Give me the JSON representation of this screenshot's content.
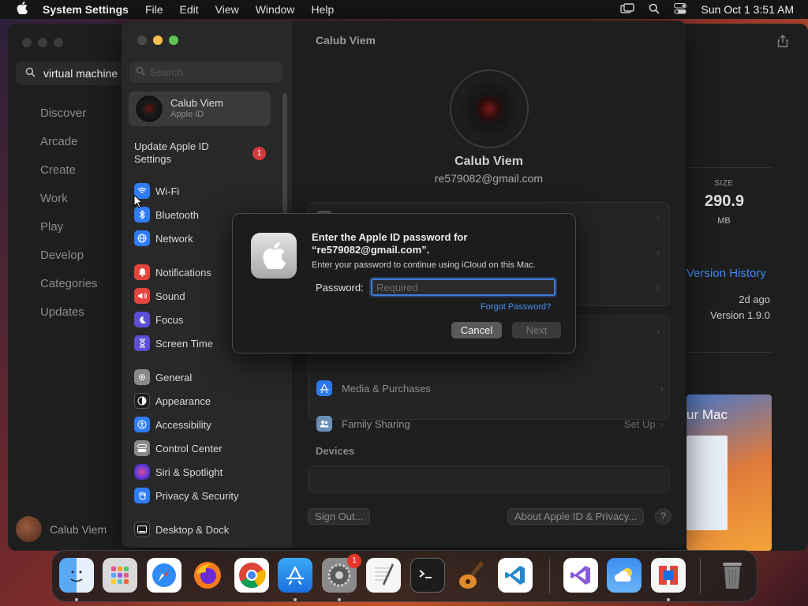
{
  "menubar": {
    "app_name": "System Settings",
    "items": [
      "File",
      "Edit",
      "View",
      "Window",
      "Help"
    ],
    "clock": "Sun Oct 1  3:51 AM"
  },
  "appstore": {
    "search_value": "virtual machine",
    "nav": [
      "Discover",
      "Arcade",
      "Create",
      "Work",
      "Play",
      "Develop",
      "Categories",
      "Updates"
    ],
    "user_name": "Calub Viem",
    "size_label": "SIZE",
    "size_value": "290.9",
    "size_unit": "MB",
    "version_history": "Version History",
    "updated_ago": "2d ago",
    "version": "Version 1.9.0",
    "promo_text": "ur Mac"
  },
  "sidebar": {
    "search_placeholder": "Search",
    "profile_name": "Calub Viem",
    "profile_sub": "Apple ID",
    "update_label": "Update Apple ID Settings",
    "update_badge": "1",
    "items": [
      {
        "label": "Wi-Fi",
        "icon": "wifi-icon",
        "color": "#2f7cf6"
      },
      {
        "label": "Bluetooth",
        "icon": "bluetooth-icon",
        "color": "#2f7cf6"
      },
      {
        "label": "Network",
        "icon": "globe-icon",
        "color": "#2f7cf6"
      },
      {
        "label": "Notifications",
        "icon": "bell-icon",
        "color": "#e2453c"
      },
      {
        "label": "Sound",
        "icon": "speaker-icon",
        "color": "#e2453c"
      },
      {
        "label": "Focus",
        "icon": "moon-icon",
        "color": "#5b4fd6"
      },
      {
        "label": "Screen Time",
        "icon": "hourglass-icon",
        "color": "#5b4fd6"
      },
      {
        "label": "General",
        "icon": "gear-icon",
        "color": "#8a8a8a"
      },
      {
        "label": "Appearance",
        "icon": "appearance-icon",
        "color": "#1c1c1c"
      },
      {
        "label": "Accessibility",
        "icon": "accessibility-icon",
        "color": "#2f7cf6"
      },
      {
        "label": "Control Center",
        "icon": "control-center-icon",
        "color": "#8a8a8a"
      },
      {
        "label": "Siri & Spotlight",
        "icon": "siri-icon",
        "color": "#b44ad8"
      },
      {
        "label": "Privacy & Security",
        "icon": "hand-icon",
        "color": "#2f7cf6"
      },
      {
        "label": "Desktop & Dock",
        "icon": "dock-icon",
        "color": "#1c1c1c"
      }
    ]
  },
  "content": {
    "title": "Calub Viem",
    "name": "Calub Viem",
    "email": "re579082@gmail.com",
    "rows": [
      {
        "label": "Media & Purchases",
        "trail": "",
        "icon": "app-store-icon",
        "color": "#2f7cf6"
      },
      {
        "label": "Family Sharing",
        "trail": "Set Up",
        "icon": "family-icon",
        "color": "#6a8fb8"
      }
    ],
    "devices_header": "Devices",
    "sign_out": "Sign Out...",
    "about": "About Apple ID & Privacy...",
    "help": "?"
  },
  "dialog": {
    "title": "Enter the Apple ID password for “re579082@gmail.com”.",
    "subtitle": "Enter your password to continue using iCloud on this Mac.",
    "password_label": "Password:",
    "password_placeholder": "Required",
    "forgot": "Forgot Password?",
    "cancel": "Cancel",
    "next": "Next"
  },
  "dock": {
    "settings_badge": "1",
    "apps": [
      "Finder",
      "Launchpad",
      "Safari",
      "Firefox",
      "Chrome",
      "App Store",
      "System Settings",
      "TextEdit",
      "Terminal",
      "GarageBand",
      "Visual Studio Code",
      "Visual Studio",
      "Weather",
      "Parallels Desktop",
      "Trash"
    ]
  }
}
